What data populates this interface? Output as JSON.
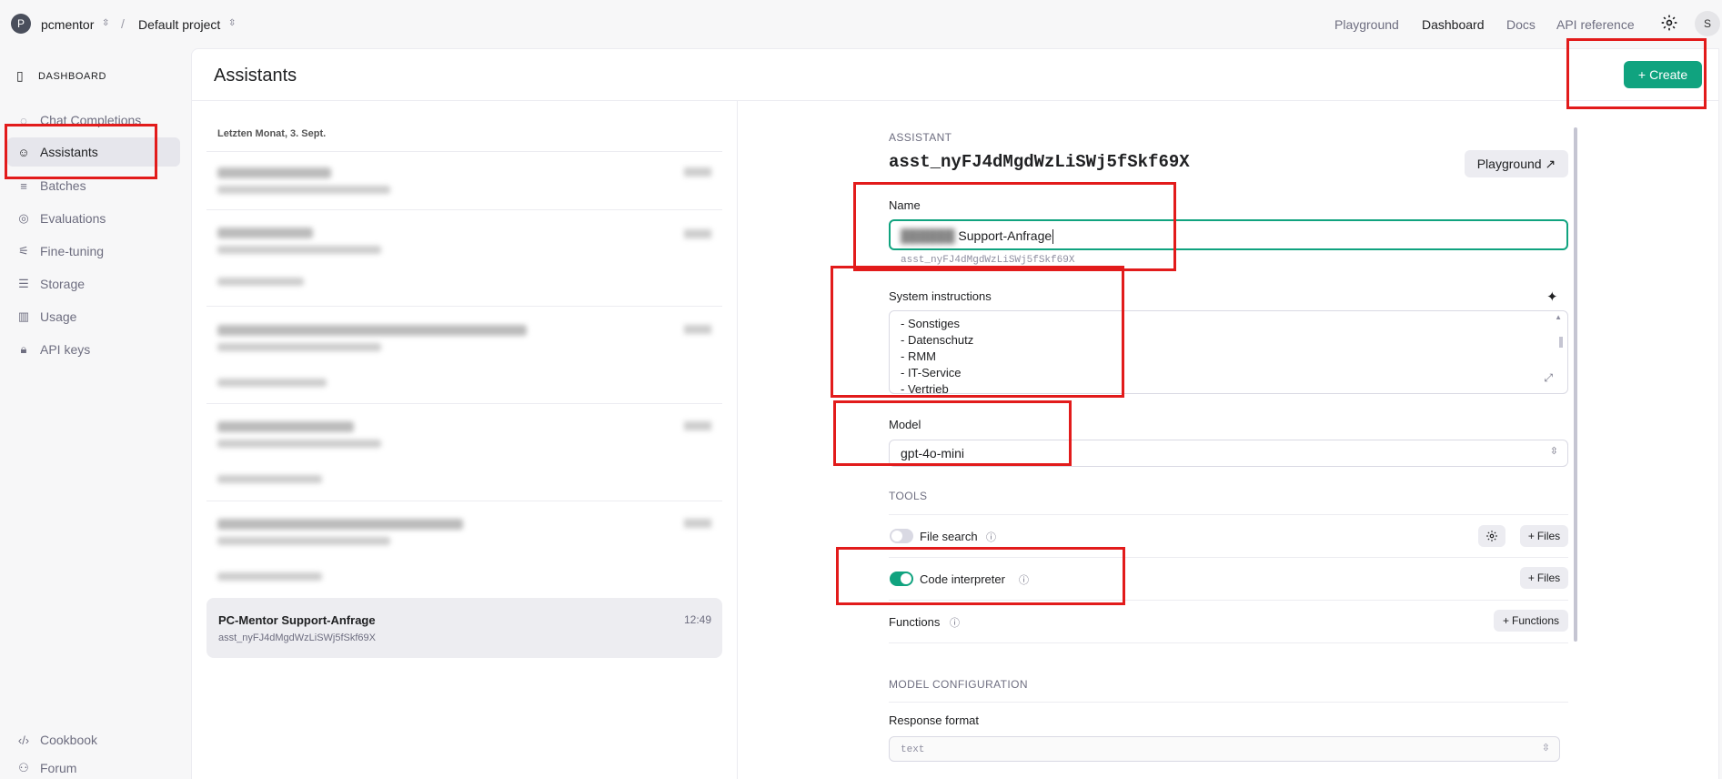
{
  "topbar": {
    "org_initial": "P",
    "org_name": "pcmentor",
    "separator": "/",
    "project_name": "Default project",
    "nav": [
      "Playground",
      "Dashboard",
      "Docs",
      "API reference"
    ],
    "active_nav": "Dashboard",
    "user_initial": "S"
  },
  "sidebar": {
    "header": "DASHBOARD",
    "items": [
      {
        "label": "Chat Completions",
        "icon": "chat-icon"
      },
      {
        "label": "Assistants",
        "icon": "robot-icon"
      },
      {
        "label": "Batches",
        "icon": "batches-icon"
      },
      {
        "label": "Evaluations",
        "icon": "evaluations-icon"
      },
      {
        "label": "Fine-tuning",
        "icon": "sliders-icon"
      },
      {
        "label": "Storage",
        "icon": "database-icon"
      },
      {
        "label": "Usage",
        "icon": "bar-chart-icon"
      },
      {
        "label": "API keys",
        "icon": "lock-icon"
      }
    ],
    "active_item": "Assistants",
    "footer": [
      {
        "label": "Cookbook",
        "icon": "code-icon"
      },
      {
        "label": "Forum",
        "icon": "users-icon"
      }
    ]
  },
  "main": {
    "title": "Assistants",
    "create_label": "Create"
  },
  "list": {
    "date_header": "Letzten Monat, 3. Sept.",
    "selected": {
      "title": "PC-Mentor Support-Anfrage",
      "id": "asst_nyFJ4dMgdWzLiSWj5fSkf69X",
      "time": "12:49"
    }
  },
  "detail": {
    "section_label": "ASSISTANT",
    "assistant_id": "asst_nyFJ4dMgdWzLiSWj5fSkf69X",
    "playground_label": "Playground",
    "name_label": "Name",
    "name_value_suffix": "Support-Anfrage",
    "name_hint_id": "asst_nyFJ4dMgdWzLiSWj5fSkf69X",
    "instructions_label": "System instructions",
    "instructions_lines": [
      "- Sonstiges",
      "- Datenschutz",
      "- RMM",
      "- IT-Service",
      "- Vertrieb"
    ],
    "model_label": "Model",
    "model_value": "gpt-4o-mini",
    "tools_label": "TOOLS",
    "file_search_label": "File search",
    "file_search_enabled": false,
    "code_interpreter_label": "Code interpreter",
    "code_interpreter_enabled": true,
    "functions_label": "Functions",
    "files_button": "Files",
    "functions_button": "Functions",
    "model_config_label": "MODEL CONFIGURATION",
    "response_format_label": "Response format",
    "response_format_value": "text"
  },
  "colors": {
    "accent": "#10a37f",
    "annotation_red": "#e21b1b"
  }
}
